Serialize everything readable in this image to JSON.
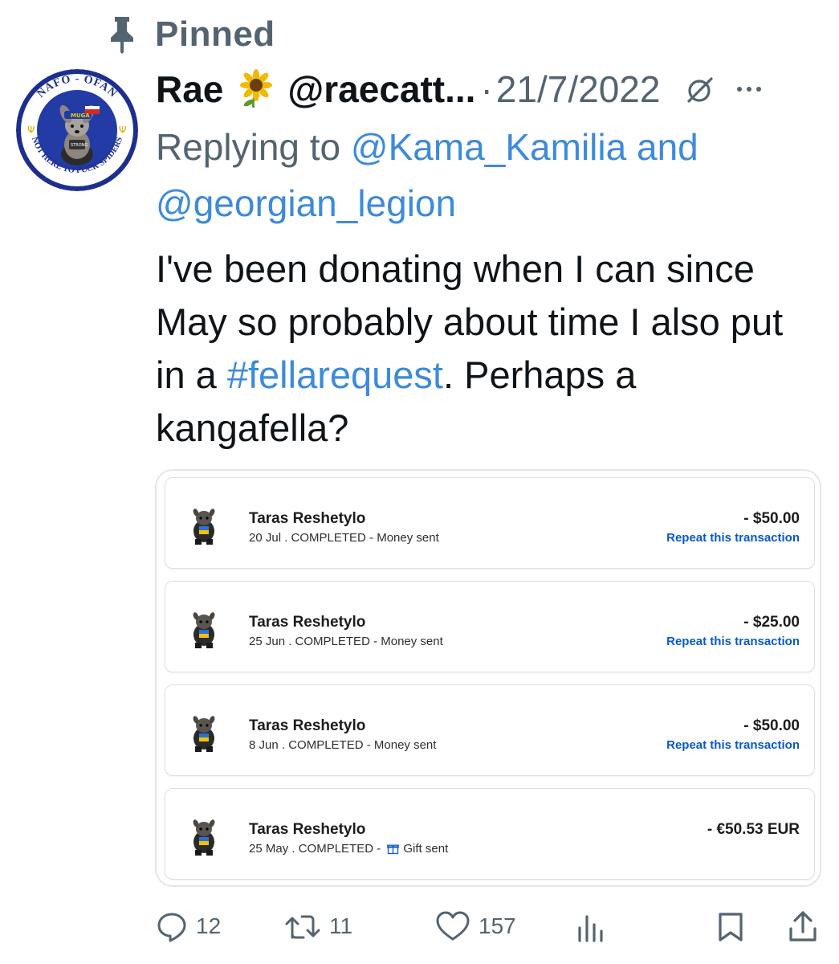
{
  "pinned_label": "Pinned",
  "tweet": {
    "display_name": "Rae",
    "emoji": "sunflower",
    "handle": "@raecatt...",
    "separator": "·",
    "date": "21/7/2022",
    "replying_prefix": "Replying to ",
    "reply_mention_1": "@Kama_Kamilia",
    "reply_and": " and",
    "reply_mention_2": "@georgian_legion",
    "text_before": "I've been donating when I can since May so probably about time I also put in a ",
    "hashtag": "#fellarequest",
    "text_after": ". Perhaps a kangafella?",
    "avatar_text": {
      "top": "NAFO - OFAN",
      "bottom": "NOT HERE TO FUCK SPIDERS",
      "cap": "MUGA"
    }
  },
  "transactions": [
    {
      "name": "Taras Reshetylo",
      "date": "20 Jul",
      "status": " . COMPLETED - ",
      "type": "Money sent",
      "amount": "- $50.00",
      "repeat": "Repeat this transaction",
      "gift": false
    },
    {
      "name": "Taras Reshetylo",
      "date": "25 Jun",
      "status": " . COMPLETED - ",
      "type": "Money sent",
      "amount": "- $25.00",
      "repeat": "Repeat this transaction",
      "gift": false
    },
    {
      "name": "Taras Reshetylo",
      "date": "8 Jun",
      "status": " . COMPLETED - ",
      "type": "Money sent",
      "amount": "- $50.00",
      "repeat": "Repeat this transaction",
      "gift": false
    },
    {
      "name": "Taras Reshetylo",
      "date": "25 May",
      "status": " . COMPLETED - ",
      "type": "Gift sent",
      "amount": "- €50.53 EUR",
      "repeat": "",
      "gift": true
    }
  ],
  "actions": {
    "replies": "12",
    "retweets": "11",
    "likes": "157"
  },
  "colors": {
    "link": "#3d8bd9",
    "muted": "#536471",
    "paypal_link": "#0a59c8"
  },
  "icons": [
    "pin-icon",
    "sunflower-emoji-icon",
    "hide-reply-icon",
    "more-icon",
    "reply-icon",
    "retweet-icon",
    "like-icon",
    "views-icon",
    "bookmark-icon",
    "share-icon",
    "gift-icon"
  ]
}
